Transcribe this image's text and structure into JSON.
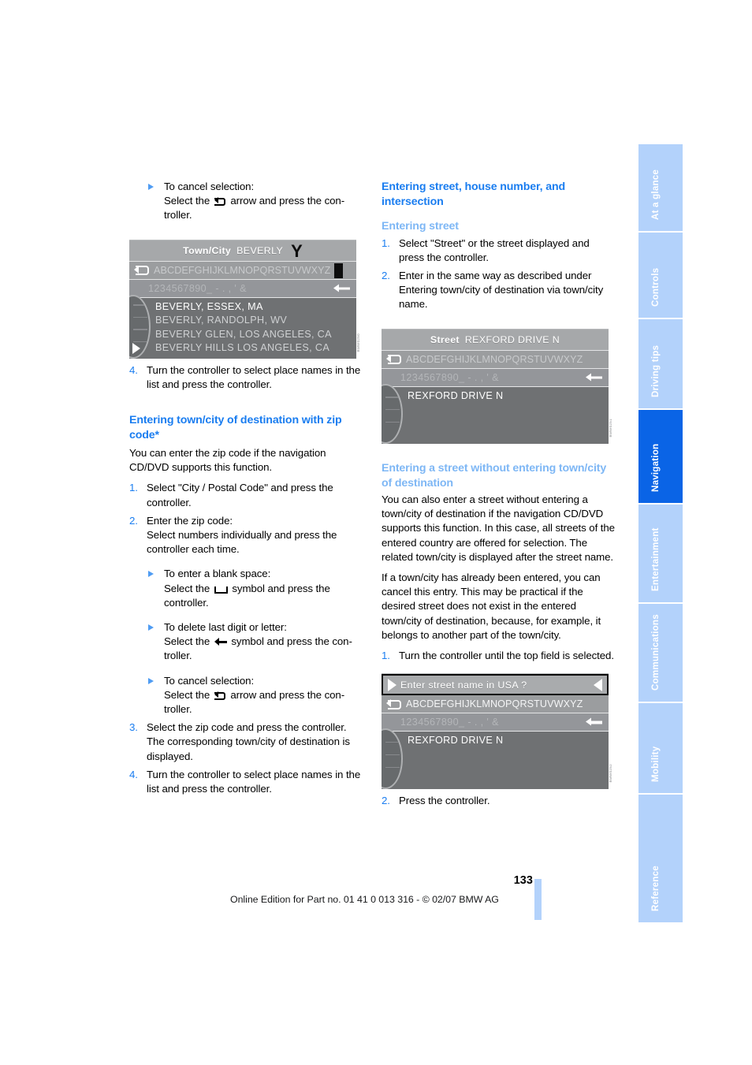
{
  "page": {
    "number": "133",
    "footer_note": "Online Edition for Part no. 01 41 0 013 316 - © 02/07 BMW AG"
  },
  "tabs": [
    {
      "label": "At a glance",
      "active": false
    },
    {
      "label": "Controls",
      "active": false
    },
    {
      "label": "Driving tips",
      "active": false
    },
    {
      "label": "Navigation",
      "active": true
    },
    {
      "label": "Entertainment",
      "active": false
    },
    {
      "label": "Communications",
      "active": false
    },
    {
      "label": "Mobility",
      "active": false
    },
    {
      "label": "Reference",
      "active": false
    }
  ],
  "left_column": {
    "cancel_bullet": {
      "line1": "To cancel selection:",
      "line2_pre": "Select the",
      "line2_post": "arrow and press the con-",
      "line3": "troller."
    },
    "figure_town_city": {
      "title_label": "Town/City",
      "title_value": "BEVERLY",
      "cursor_char": "Y",
      "alpha_row": "ABCDEFGHIJKLMNOPQRSTUVWXYZ",
      "num_row": "1234567890_ - . , ' &",
      "list": [
        "BEVERLY, ESSEX, MA",
        "BEVERLY, RANDOLPH, WV",
        "BEVERLY GLEN, LOS ANGELES, CA",
        "BEVERLY HILLS LOS ANGELES, CA"
      ]
    },
    "step4": {
      "num": "4.",
      "text": "Turn the controller to select place names in the list and press the controller."
    },
    "zip_heading": "Entering town/city of destination with zip code*",
    "zip_intro": "You can enter the zip code if the navigation CD/DVD supports this function.",
    "zip_step1": {
      "num": "1.",
      "text": "Select \"City / Postal Code\" and press the controller."
    },
    "zip_step2": {
      "num": "2.",
      "line1": "Enter the zip code:",
      "line2": "Select numbers individually and press the controller each time."
    },
    "blank_space_bullet": {
      "line1": "To enter a blank space:",
      "line2_pre": "Select the",
      "line2_post": "symbol and press the",
      "line3": "controller."
    },
    "delete_bullet": {
      "line1": "To delete last digit or letter:",
      "line2_pre": "Select the",
      "line2_post": "symbol and press the con-",
      "line3": "troller."
    },
    "cancel_bullet2": {
      "line1": "To cancel selection:",
      "line2_pre": "Select the",
      "line2_post": "arrow and press the con-",
      "line3": "troller."
    },
    "zip_step3": {
      "num": "3.",
      "text": "Select the zip code and press the controller. The corresponding town/city of destination is displayed."
    },
    "zip_step4": {
      "num": "4.",
      "text": "Turn the controller to select place names in the list and press the controller."
    }
  },
  "right_column": {
    "main_heading": "Entering street, house number, and intersection",
    "street_heading": "Entering street",
    "street_step1": {
      "num": "1.",
      "text": "Select \"Street\" or the street displayed and press the controller."
    },
    "street_step2": {
      "num": "2.",
      "text": "Enter in the same way as described under Entering town/city of destination via town/city name."
    },
    "figure_street": {
      "title_label": "Street",
      "title_value": "REXFORD DRIVE N",
      "alpha_row": "ABCDEFGHIJKLMNOPQRSTUVWXYZ",
      "num_row": "1234567890_ - . , ' &",
      "list": [
        "REXFORD DRIVE N"
      ]
    },
    "without_heading": "Entering a street without entering town/city of destination",
    "without_para1": "You can also enter a street without entering a town/city of destination if the navigation CD/DVD supports this function. In this case, all streets of the entered country are offered for selection. The related town/city is displayed after the street name.",
    "without_para2": "If a town/city has already been entered, you can cancel this entry. This may be practical if the desired street does not exist in the entered town/city of destination, because, for example, it belongs to another part of the town/city.",
    "without_step1": {
      "num": "1.",
      "text": "Turn the controller until the top field is selected."
    },
    "figure_country": {
      "prompt": "Enter street name in USA ?",
      "alpha_row": "ABCDEFGHIJKLMNOPQRSTUVWXYZ",
      "num_row": "1234567890_ - . , ' &",
      "list": [
        "REXFORD DRIVE N"
      ]
    },
    "without_step2": {
      "num": "2.",
      "text": "Press the controller."
    }
  },
  "colors": {
    "accent_heading": "#1a7df0",
    "sub_heading": "#7eb7f5",
    "tab_inactive": "#b3d2fb",
    "tab_active": "#0a64e6",
    "screen_grey": "#6f7173"
  }
}
